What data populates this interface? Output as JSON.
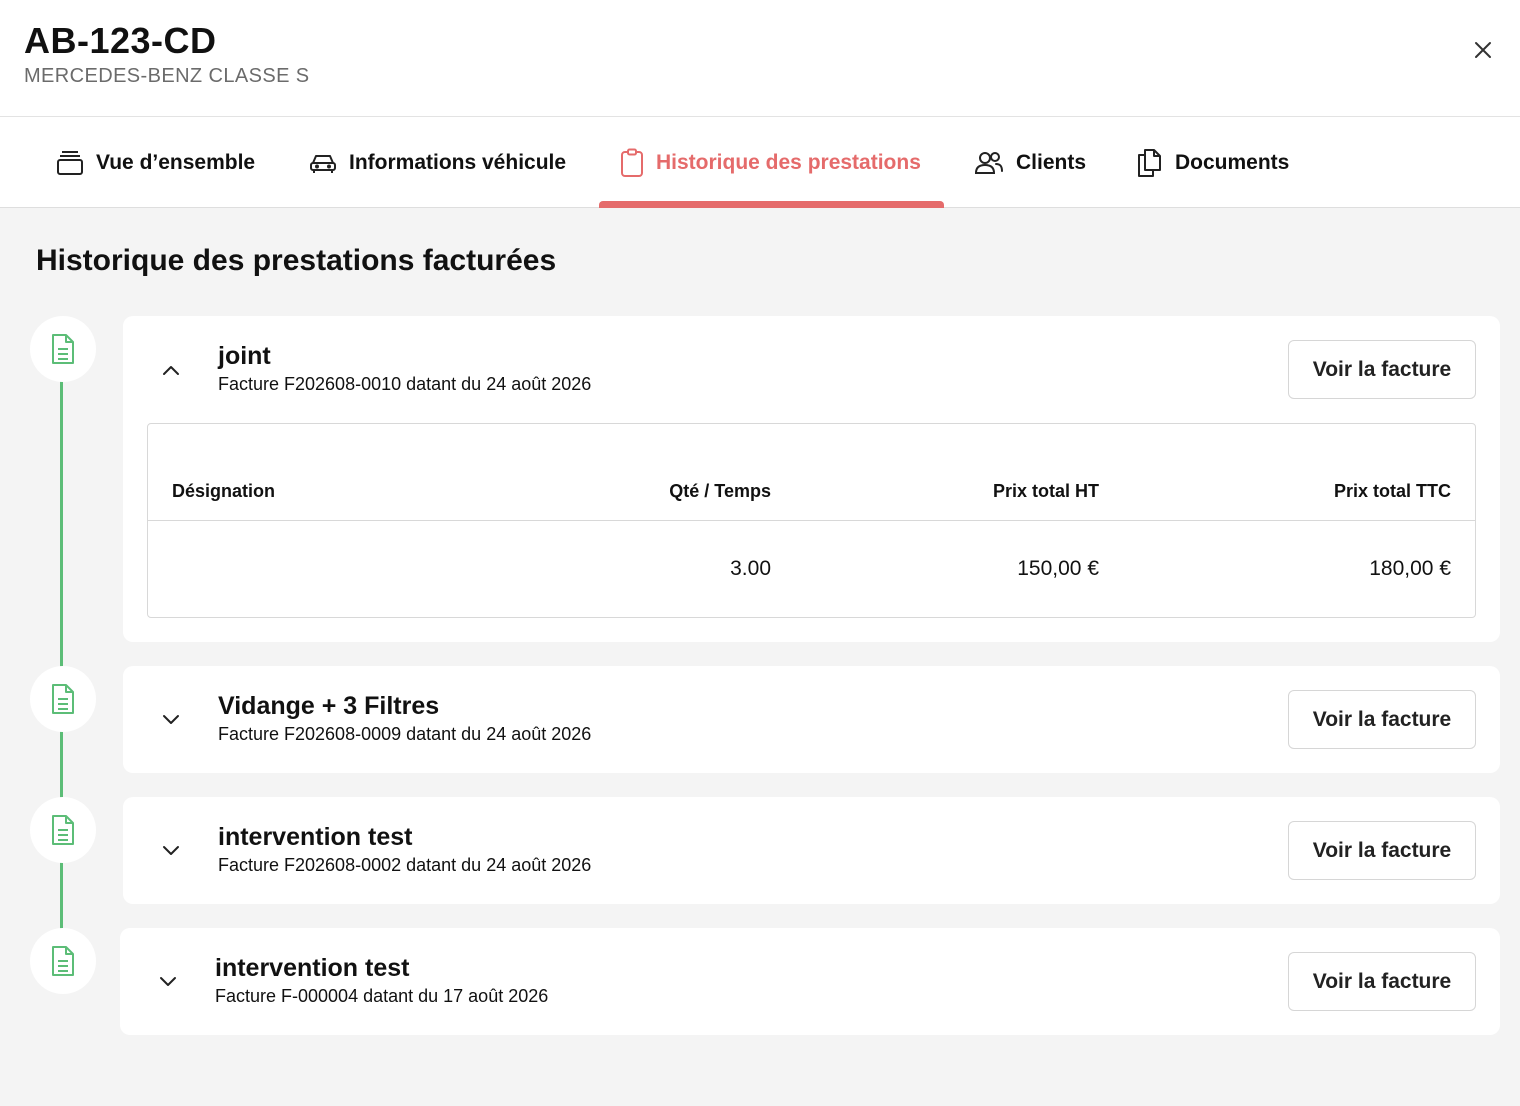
{
  "header": {
    "plate": "AB-123-CD",
    "model": "MERCEDES-BENZ CLASSE S"
  },
  "tabs": [
    {
      "label": "Vue d’ensemble",
      "icon": "cards-stack-icon"
    },
    {
      "label": "Informations véhicule",
      "icon": "car-icon"
    },
    {
      "label": "Historique des prestations",
      "icon": "clipboard-icon",
      "active": true
    },
    {
      "label": "Clients",
      "icon": "users-icon"
    },
    {
      "label": "Documents",
      "icon": "documents-icon"
    }
  ],
  "section": {
    "title": "Historique des prestations facturées"
  },
  "invoices": [
    {
      "title": "joint",
      "subtitle": "Facture F202608-0010 datant du 24 août 2026",
      "button": "Voir la facture",
      "expanded": true,
      "table": {
        "headers": [
          "Désignation",
          "Qté / Temps",
          "Prix total HT",
          "Prix total TTC"
        ],
        "rows": [
          [
            "",
            "3.00",
            "150,00 €",
            "180,00 €"
          ]
        ]
      }
    },
    {
      "title": "Vidange + 3 Filtres",
      "subtitle": "Facture F202608-0009 datant du 24 août 2026",
      "button": "Voir la facture",
      "expanded": false
    },
    {
      "title": "intervention test",
      "subtitle": "Facture F202608-0002 datant du 24 août 2026",
      "button": "Voir la facture",
      "expanded": false
    },
    {
      "title": "intervention test",
      "subtitle": "Facture F-000004 datant du 17 août 2026",
      "button": "Voir la facture",
      "expanded": false
    }
  ],
  "colors": {
    "accent": "#e56b6b",
    "timeline": "#5cbd77",
    "background": "#f4f4f4"
  }
}
